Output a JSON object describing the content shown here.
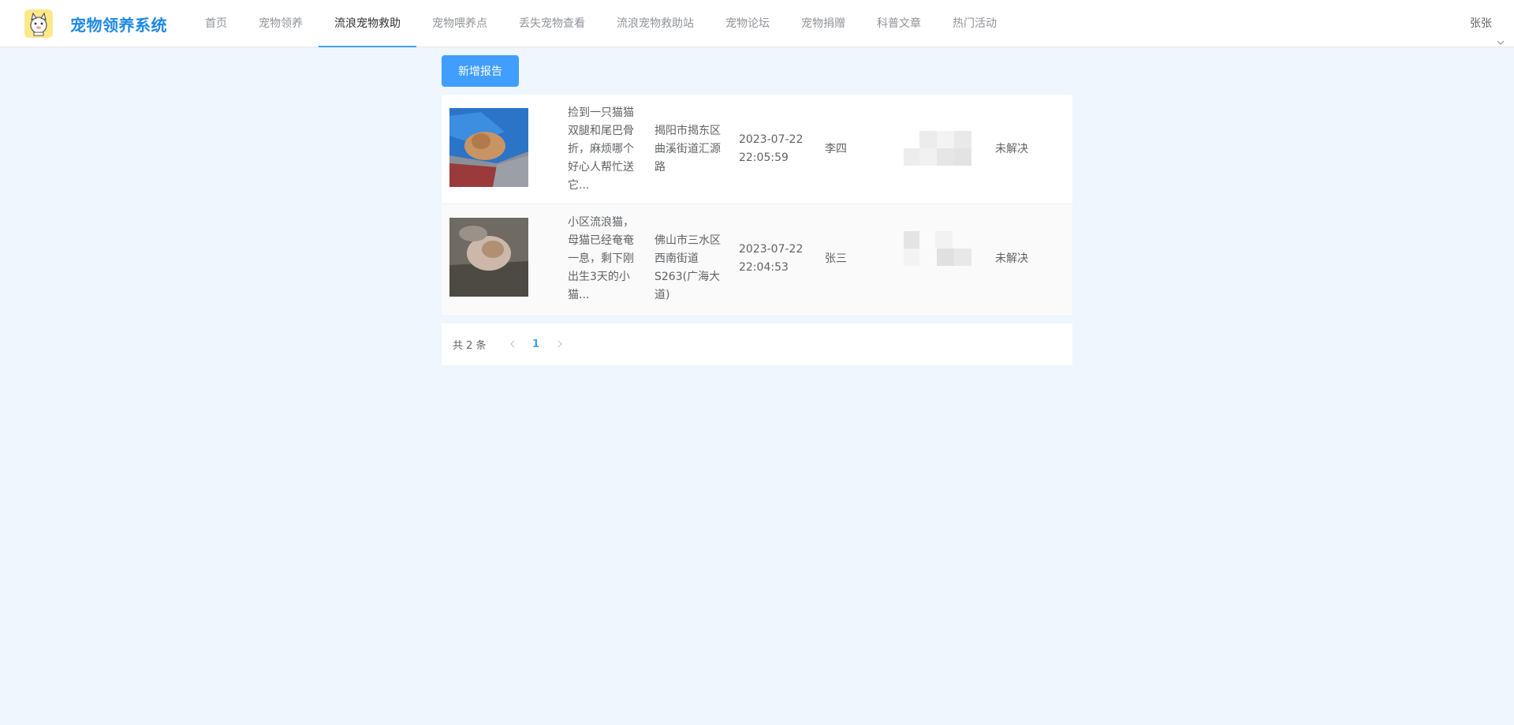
{
  "app": {
    "title": "宠物领养系统"
  },
  "nav": {
    "items": [
      {
        "label": "首页"
      },
      {
        "label": "宠物领养"
      },
      {
        "label": "流浪宠物救助"
      },
      {
        "label": "宠物喂养点"
      },
      {
        "label": "丢失宠物查看"
      },
      {
        "label": "流浪宠物救助站"
      },
      {
        "label": "宠物论坛"
      },
      {
        "label": "宠物捐赠"
      },
      {
        "label": "科普文章"
      },
      {
        "label": "热门活动"
      }
    ],
    "active_index": 2
  },
  "user": {
    "name": "张张"
  },
  "actions": {
    "add_report_label": "新增报告"
  },
  "reports": [
    {
      "description": "捡到一只猫猫双腿和尾巴骨折，麻烦哪个好心人帮忙送它...",
      "address": "揭阳市揭东区曲溪街道汇源路",
      "time": "2023-07-22 22:05:59",
      "reporter": "李四",
      "status": "未解决"
    },
    {
      "description": "小区流浪猫，母猫已经奄奄一息，剩下刚出生3天的小猫...",
      "address": "佛山市三水区西南街道S263(广海大道)",
      "time": "2023-07-22 22:04:53",
      "reporter": "张三",
      "status": "未解决"
    }
  ],
  "pagination": {
    "total_text": "共 2 条",
    "current_page": "1",
    "prev_icon": "chevron-left-icon",
    "next_icon": "chevron-right-icon"
  },
  "colors": {
    "primary": "#409eff",
    "brand_title": "#1e88e5",
    "background": "#eff6fd"
  }
}
